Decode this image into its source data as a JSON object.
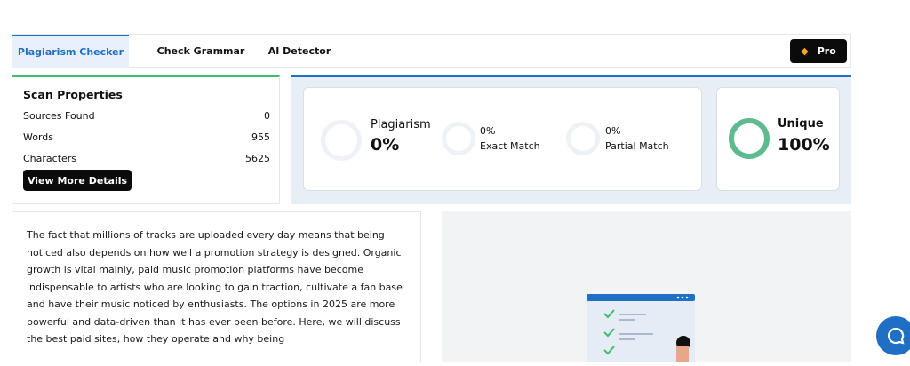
{
  "tabs": [
    {
      "label": "Plagiarism Checker",
      "active": true
    },
    {
      "label": "Check Grammar",
      "active": false
    },
    {
      "label": "AI Detector",
      "active": false
    }
  ],
  "pro_button": {
    "label": "Pro",
    "icon": "diamond-icon"
  },
  "scan_properties": {
    "title": "Scan Properties",
    "rows": [
      {
        "label": "Sources Found",
        "value": "0"
      },
      {
        "label": "Words",
        "value": "955"
      },
      {
        "label": "Characters",
        "value": "5625"
      }
    ],
    "button_label": "View More Details"
  },
  "results": {
    "plagiarism": {
      "label": "Plagiarism",
      "value": "0%"
    },
    "exact_match": {
      "label": "Exact Match",
      "value": "0%"
    },
    "partial_match": {
      "label": "Partial Match",
      "value": "0%"
    },
    "unique": {
      "label": "Unique",
      "value": "100%"
    }
  },
  "body_text": "The fact that millions of tracks are uploaded every day means that being noticed also depends on how well a promotion strategy is designed. Organic growth is vital mainly, paid music promotion platforms have become indispensable to artists who are looking to gain traction, cultivate a fan base and have their music noticed by enthusiasts. The options in 2025 are more powerful and data-driven than it has ever been before. Here, we will discuss the best paid sites, how they operate and why being",
  "colors": {
    "accent": "#1f6fc5",
    "green": "#3dbf6f",
    "unique_ring": "#5dbb8f"
  }
}
